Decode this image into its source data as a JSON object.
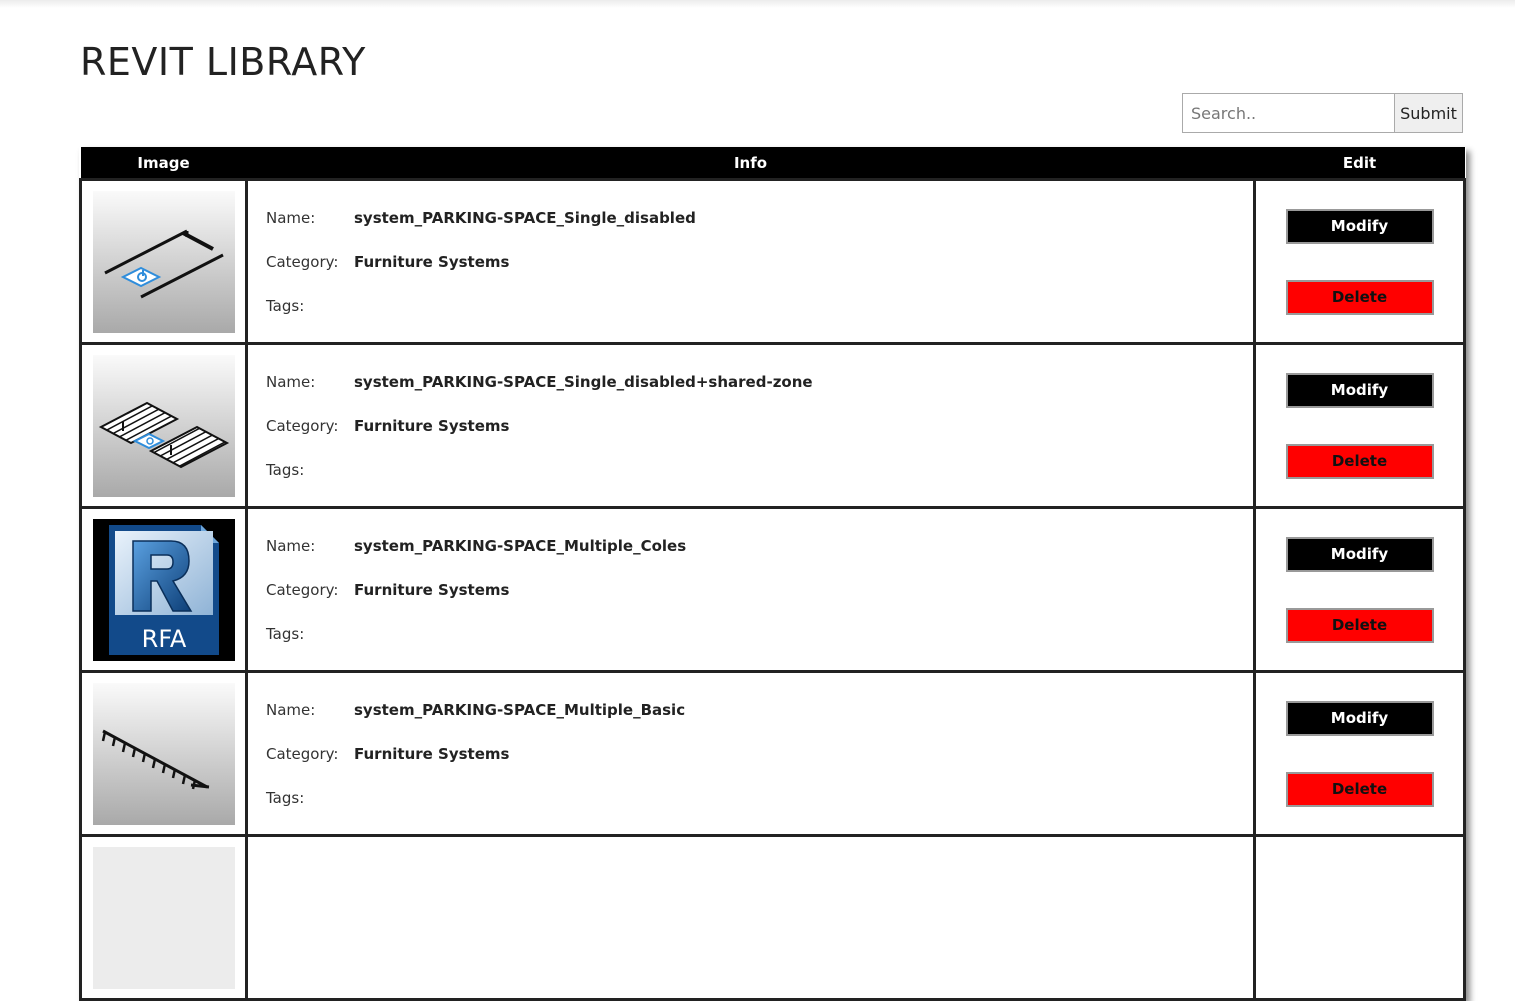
{
  "page": {
    "title": "REVIT LIBRARY"
  },
  "search": {
    "placeholder": "Search..",
    "value": "",
    "submit_label": "Submit"
  },
  "table": {
    "headers": {
      "image": "Image",
      "info": "Info",
      "edit": "Edit"
    },
    "labels": {
      "name": "Name:",
      "category": "Category:",
      "tags": "Tags:"
    },
    "buttons": {
      "modify": "Modify",
      "delete": "Delete"
    },
    "rows": [
      {
        "name": "system_PARKING-SPACE_Single_disabled",
        "category": "Furniture Systems",
        "tags": "",
        "thumbnail_icon": "single-disabled-parking-icon"
      },
      {
        "name": "system_PARKING-SPACE_Single_disabled+shared-zone",
        "category": "Furniture Systems",
        "tags": "",
        "thumbnail_icon": "shared-zone-parking-icon"
      },
      {
        "name": "system_PARKING-SPACE_Multiple_Coles",
        "category": "Furniture Systems",
        "tags": "",
        "thumbnail_icon": "rfa-file-icon",
        "thumbnail_text": "RFA"
      },
      {
        "name": "system_PARKING-SPACE_Multiple_Basic",
        "category": "Furniture Systems",
        "tags": "",
        "thumbnail_icon": "multiple-parking-icon"
      },
      {
        "name": "",
        "category": "",
        "tags": "",
        "thumbnail_icon": ""
      }
    ]
  },
  "colors": {
    "header_bg": "#000000",
    "modify_bg": "#000000",
    "delete_bg": "#ff0000",
    "accessible_blue": "#2f8ddb"
  }
}
